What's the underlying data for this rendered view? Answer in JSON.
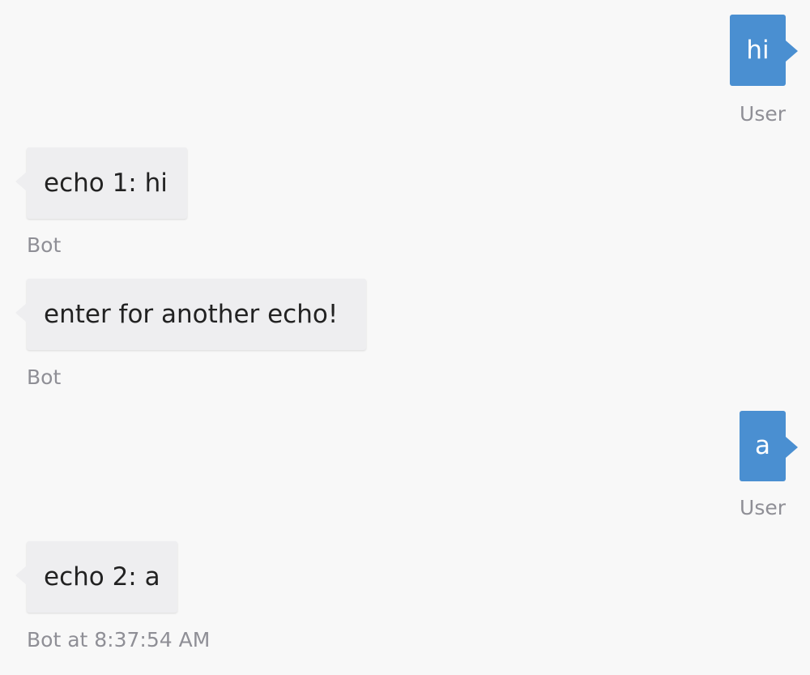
{
  "messages": [
    {
      "from": "User",
      "text": "hi",
      "meta": "User"
    },
    {
      "from": "Bot",
      "text": "echo 1: hi",
      "meta": "Bot"
    },
    {
      "from": "Bot",
      "text": "enter for another echo!",
      "meta": "Bot"
    },
    {
      "from": "User",
      "text": "a",
      "meta": "User"
    },
    {
      "from": "Bot",
      "text": "echo 2: a",
      "meta": "Bot at 8:37:54 AM"
    }
  ],
  "colors": {
    "background": "#f8f8f8",
    "user_bubble": "#4a8fd1",
    "bot_bubble": "#eeeef0",
    "meta_text": "#8f8f96"
  }
}
